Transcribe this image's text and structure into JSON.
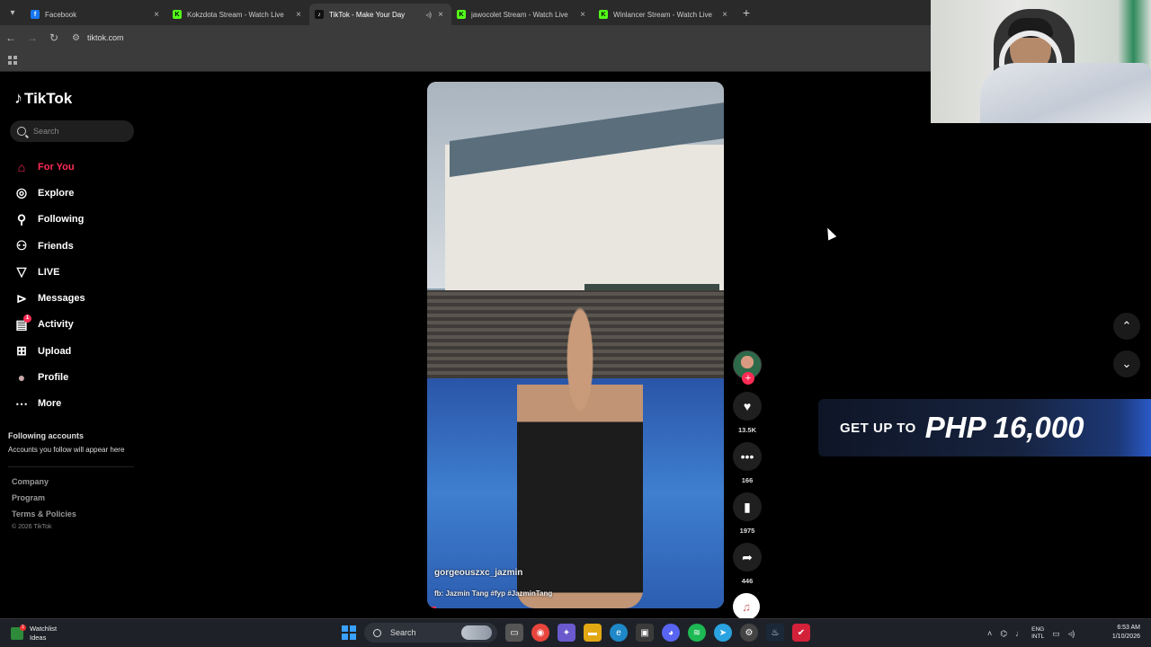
{
  "browser": {
    "tabs": [
      {
        "title": "Facebook",
        "favicon": "facebook-icon",
        "color": "#1877f2",
        "glyph": "f"
      },
      {
        "title": "Kokzdota Stream - Watch Live",
        "favicon": "kick-icon",
        "color": "#53fc18",
        "glyph": "K"
      },
      {
        "title": "TikTok - Make Your Day",
        "favicon": "tiktok-icon",
        "color": "#111111",
        "glyph": "♪",
        "active": true,
        "audio": true
      },
      {
        "title": "jawocolet Stream - Watch Live",
        "favicon": "kick-icon",
        "color": "#53fc18",
        "glyph": "K"
      },
      {
        "title": "Winlancer Stream - Watch Live",
        "favicon": "kick-icon",
        "color": "#53fc18",
        "glyph": "K"
      }
    ],
    "url": "tiktok.com"
  },
  "tiktok": {
    "brand": "TikTok",
    "search_placeholder": "Search",
    "nav": [
      {
        "label": "For You",
        "icon": "home-icon"
      },
      {
        "label": "Explore",
        "icon": "compass-icon"
      },
      {
        "label": "Following",
        "icon": "following-icon"
      },
      {
        "label": "Friends",
        "icon": "friends-icon"
      },
      {
        "label": "LIVE",
        "icon": "live-icon"
      },
      {
        "label": "Messages",
        "icon": "messages-icon"
      },
      {
        "label": "Activity",
        "icon": "activity-icon",
        "badge": "1"
      },
      {
        "label": "Upload",
        "icon": "upload-icon"
      },
      {
        "label": "Profile",
        "icon": "profile-avatar"
      },
      {
        "label": "More",
        "icon": "more-icon"
      }
    ],
    "following_accounts_title": "Following accounts",
    "following_accounts_sub": "Accounts you follow will appear here",
    "footer": {
      "company": "Company",
      "program": "Program",
      "terms": "Terms & Policies",
      "copyright": "© 2026 TikTok"
    },
    "video": {
      "username": "gorgeouszxc_jazmin",
      "description": "fb: Jazmin Tang #fyp #JazminTang",
      "progress_percent": 3,
      "likes": "13.5K",
      "comments": "166",
      "saves": "1975",
      "shares": "446"
    }
  },
  "promo": {
    "prefix": "GET UP TO",
    "amount": "PHP 16,000"
  },
  "taskbar": {
    "weather_line1": "Watchlist",
    "weather_line2": "Ideas",
    "weather_badge": "1",
    "search_label": "Search",
    "lang_line1": "ENG",
    "lang_line2": "INTL",
    "time": "6:53 AM",
    "date": "1/10/2026"
  }
}
